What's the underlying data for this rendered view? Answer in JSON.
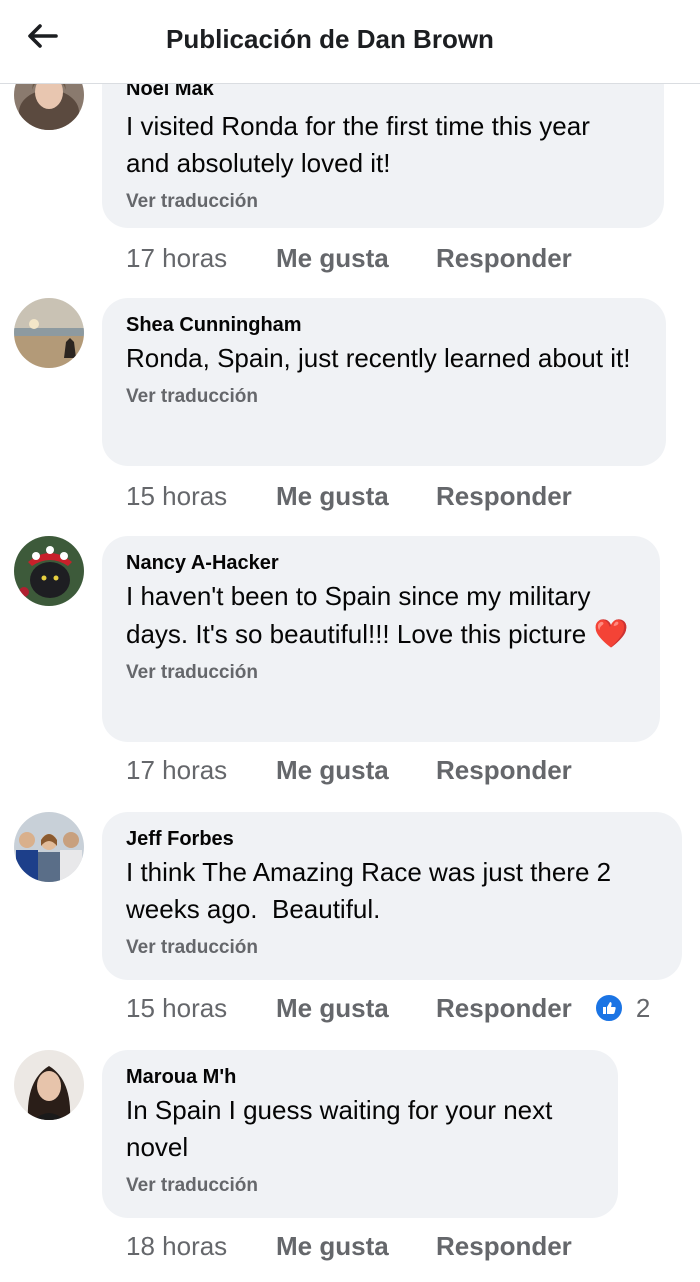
{
  "header": {
    "title": "Publicación de Dan Brown",
    "back_icon": "arrow-left-icon"
  },
  "colors": {
    "bubble": "#f0f2f5",
    "secondary_text": "#65676b",
    "like_blue": "#1b74e4",
    "heart_red": "#e02a3b"
  },
  "comments": [
    {
      "author": "Noel Mak",
      "text": "I visited Ronda for the first time this year and absolutely loved it!",
      "translate": "Ver traducción",
      "time": "17 horas",
      "like": "Me gusta",
      "reply": "Responder"
    },
    {
      "author": "Shea Cunningham",
      "text": "Ronda, Spain, just recently learned about it!",
      "translate": "Ver traducción",
      "time": "15 horas",
      "like": "Me gusta",
      "reply": "Responder"
    },
    {
      "author": "Nancy A-Hacker",
      "text": "I haven't been to Spain since my military days. It's so beautiful!!! Love this picture",
      "emoji": "❤️",
      "translate": "Ver traducción",
      "time": "17 horas",
      "like": "Me gusta",
      "reply": "Responder"
    },
    {
      "author": "Jeff Forbes",
      "text": "I think The Amazing Race was just there 2 weeks ago.  Beautiful.",
      "translate": "Ver traducción",
      "time": "15 horas",
      "like": "Me gusta",
      "reply": "Responder",
      "reaction_icon": "thumbs-up-icon",
      "reaction_count": "2"
    },
    {
      "author": "Maroua M'h",
      "text": "In Spain I guess waiting for your next novel",
      "translate": "Ver traducción",
      "time": "18 horas",
      "like": "Me gusta",
      "reply": "Responder"
    }
  ]
}
